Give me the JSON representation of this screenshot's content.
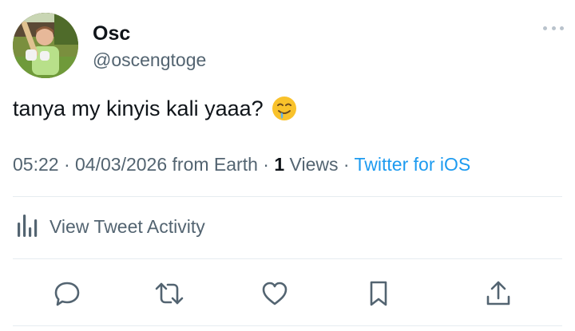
{
  "author": {
    "name": "Osc",
    "handle": "@oscengtoge"
  },
  "tweet": {
    "text": "tanya my kinyis kali yaaa?",
    "emoji": "drooling-face"
  },
  "meta": {
    "time": "05:22",
    "sep1": " · ",
    "date": "04/03/2026",
    "location": " from Earth",
    "sep2": " · ",
    "views_count": "1",
    "views_label": " Views",
    "sep3": " · ",
    "source": "Twitter for iOS"
  },
  "activity": {
    "label": "View Tweet Activity"
  },
  "colors": {
    "accent": "#1d9bf0",
    "secondary_text": "#536471",
    "primary_text": "#0f1419",
    "divider": "#e6ecf0"
  },
  "icons": [
    "more-icon",
    "bar-chart-icon",
    "reply-icon",
    "retweet-icon",
    "like-icon",
    "bookmark-icon",
    "share-icon"
  ]
}
